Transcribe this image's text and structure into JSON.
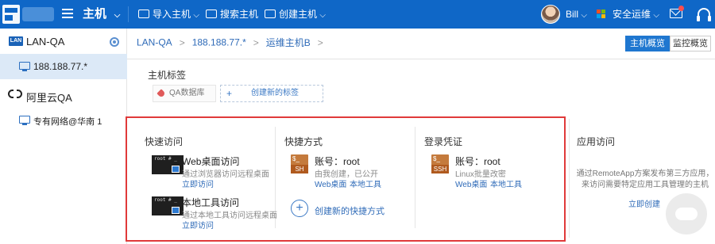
{
  "topbar": {
    "module_title": "主机",
    "menu": [
      {
        "label": "导入主机"
      },
      {
        "label": "搜索主机"
      },
      {
        "label": "创建主机"
      }
    ],
    "user_name": "Bill",
    "org_name": "安全运维"
  },
  "sidebar": {
    "groups": [
      {
        "badge": "LAN",
        "label": "LAN-QA"
      },
      {
        "label": "188.188.77.*"
      },
      {
        "label": "阿里云QA"
      },
      {
        "label": "专有网络@华南 1"
      }
    ]
  },
  "breadcrumb": [
    "LAN-QA",
    "188.188.77.*",
    "运维主机B"
  ],
  "view_tabs": [
    "主机概览",
    "监控概览"
  ],
  "tags": {
    "title": "主机标签",
    "items": [
      "QA数据库"
    ],
    "create_label": "创建新的标签"
  },
  "quick_access": {
    "title": "快速访问",
    "items": [
      {
        "name": "Web桌面访问",
        "desc": "通过浏览器访问远程桌面",
        "link": "立即访问"
      },
      {
        "name": "本地工具访问",
        "desc": "通过本地工具访问远程桌面",
        "link": "立即访问"
      }
    ],
    "term_text": "root # _"
  },
  "shortcuts": {
    "title": "快捷方式",
    "account": "账号：root",
    "desc": "由我创建，已公开",
    "links": [
      "Web桌面",
      "本地工具"
    ],
    "create_label": "创建新的快捷方式",
    "icon_text": "SH"
  },
  "credentials": {
    "title": "登录凭证",
    "account": "账号：root",
    "desc": "Linux批量改密",
    "links": [
      "Web桌面",
      "本地工具"
    ],
    "icon_text": "SSH"
  },
  "app_access": {
    "title": "应用访问",
    "desc": "通过RemoteApp方案发布第三方应用，来访问需要特定应用工具管理的主机",
    "link": "立即创建"
  },
  "colors": {
    "topbar": "#0f67c7",
    "sidebar_active": "#dce9f7",
    "link": "#2f6bb8",
    "highlight_border": "#e03a3a"
  }
}
